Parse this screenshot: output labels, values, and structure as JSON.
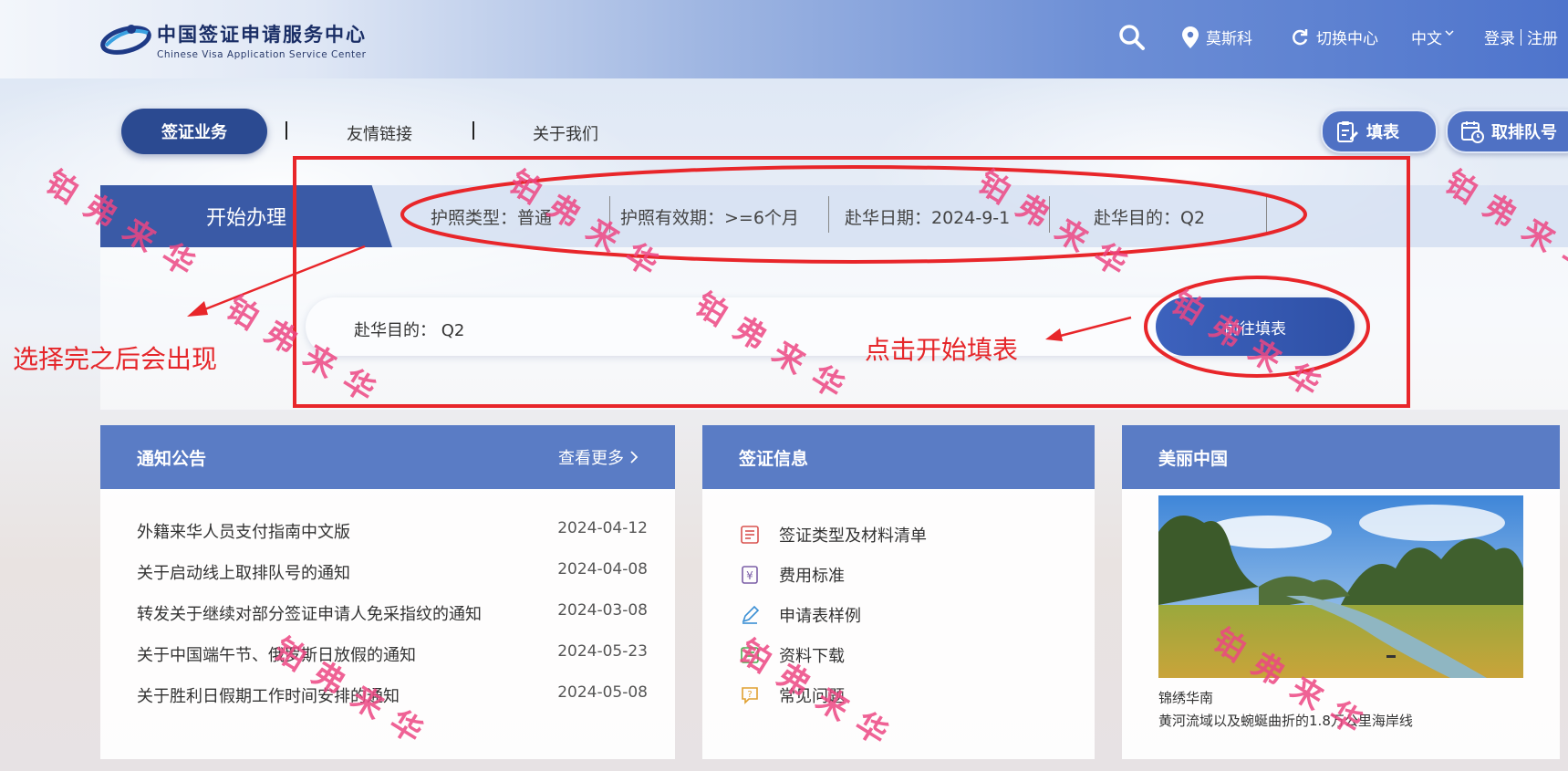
{
  "header": {
    "logo_cn": "中国签证申请服务中心",
    "logo_en": "Chinese Visa Application Service Center",
    "location": "莫斯科",
    "switch_center": "切换中心",
    "language": "中文",
    "login": "登录",
    "register": "注册"
  },
  "nav": {
    "active": "签证业务",
    "links": [
      "友情链接",
      "关于我们"
    ],
    "fill_form": "填表",
    "queue": "取排队号"
  },
  "start": {
    "tab": "开始办理",
    "passport_type": "护照类型：普通",
    "passport_validity": "护照有效期：>=6个月",
    "arrival_date": "赴华日期：2024-9-1",
    "purpose": "赴华目的：Q2",
    "purpose_bar": "赴华目的：  Q2",
    "go_button": "前往填表"
  },
  "annotations": {
    "appear_note": "选择完之后会出现",
    "click_note": "点击开始填表"
  },
  "notices": {
    "title": "通知公告",
    "more": "查看更多",
    "items": [
      {
        "title": "外籍来华人员支付指南中文版",
        "date": "2024-04-12"
      },
      {
        "title": "关于启动线上取排队号的通知",
        "date": "2024-04-08"
      },
      {
        "title": "转发关于继续对部分签证申请人免采指纹的通知",
        "date": "2024-03-08"
      },
      {
        "title": "关于中国端午节、俄罗斯日放假的通知",
        "date": "2024-05-23"
      },
      {
        "title": "关于胜利日假期工作时间安排的通知",
        "date": "2024-05-08"
      }
    ]
  },
  "visa_info": {
    "title": "签证信息",
    "items": [
      "签证类型及材料清单",
      "费用标准",
      "申请表样例",
      "资料下载",
      "常见问题"
    ]
  },
  "beautiful_china": {
    "title": "美丽中国",
    "caption1": "锦绣华南",
    "caption2": "黄河流域以及蜿蜒曲折的1.8万公里海岸线"
  },
  "watermark": "铂弗来华",
  "colors": {
    "brand_blue": "#2b4a91",
    "card_header": "#5a7cc5",
    "annotation_red": "#e8262a",
    "watermark_pink": "#ec4682"
  }
}
